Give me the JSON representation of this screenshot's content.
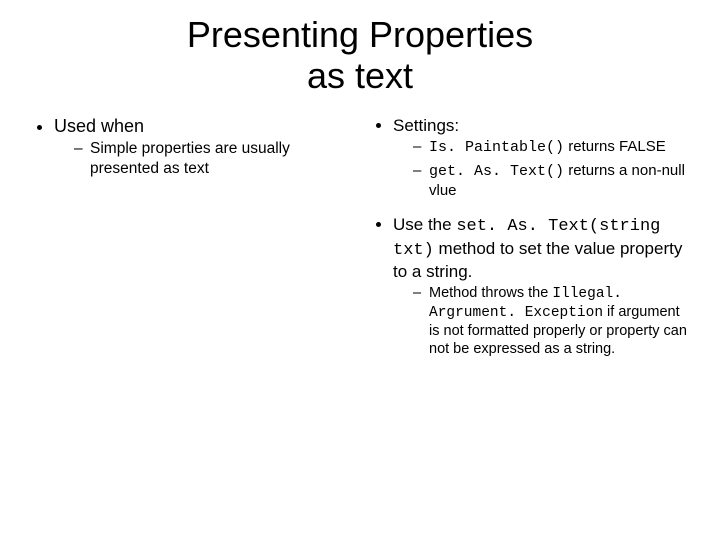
{
  "title_line1": "Presenting Properties",
  "title_line2": "as text",
  "left": {
    "l1": "Used when",
    "l1_1": "Simple properties are usually presented as text"
  },
  "right": {
    "r1": "Settings:",
    "r1_1_code": "Is. Paintable()",
    "r1_1_rest": " returns FALSE",
    "r1_2_code": "get. As. Text()",
    "r1_2_rest": " returns a non-null vlue",
    "r2_pre": "Use the ",
    "r2_code": "set. As. Text(string txt)",
    "r2_post": " method to set the value property to a string.",
    "r2_1_pre": "Method throws the ",
    "r2_1_code": "Illegal. Argrument. Exception",
    "r2_1_post": " if argument is not formatted properly or property can not be expressed as a string."
  }
}
